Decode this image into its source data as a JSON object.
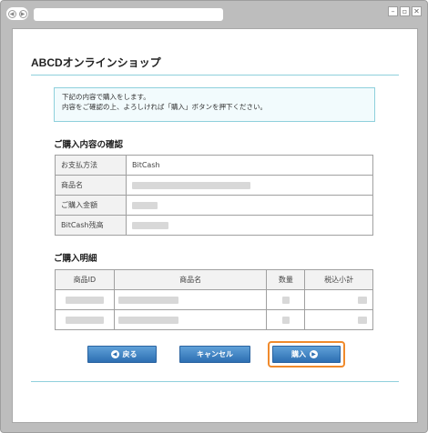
{
  "shop_title": "ABCDオンラインショップ",
  "notice": {
    "line1": "下記の内容で購入をします。",
    "line2": "内容をご確認の上、よろしければ「購入」ボタンを押下ください。"
  },
  "confirm": {
    "heading": "ご購入内容の確認",
    "rows": [
      {
        "label": "お支払方法",
        "value": "BitCash"
      },
      {
        "label": "商品名",
        "value": ""
      },
      {
        "label": "ご購入金額",
        "value": ""
      },
      {
        "label": "BitCash残高",
        "value": ""
      }
    ]
  },
  "details": {
    "heading": "ご購入明細",
    "headers": [
      "商品ID",
      "商品名",
      "数量",
      "税込小計"
    ]
  },
  "buttons": {
    "back": "戻る",
    "cancel": "キャンセル",
    "buy": "購入"
  }
}
